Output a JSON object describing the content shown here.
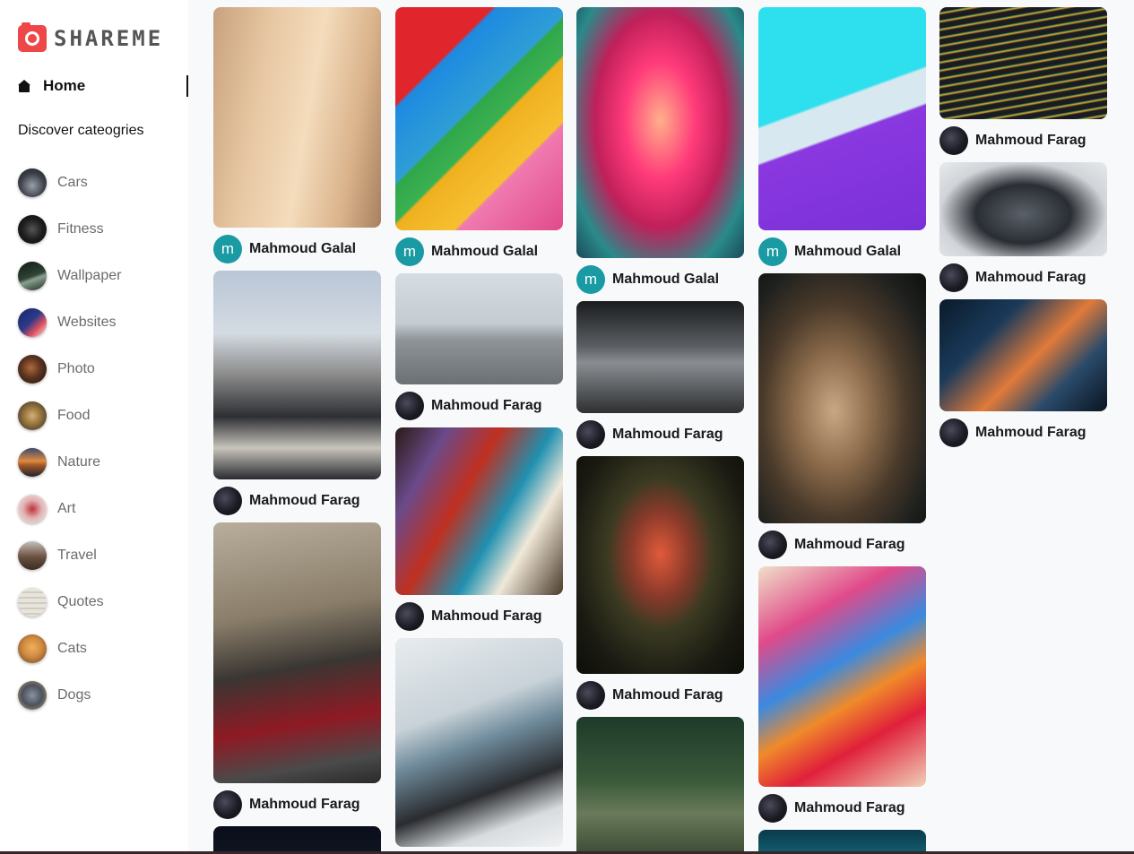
{
  "app": {
    "name": "SHAREME"
  },
  "nav": {
    "home_label": "Home",
    "discover_label": "Discover cateogries"
  },
  "categories": [
    {
      "label": "Cars",
      "color": "#3b3f48"
    },
    {
      "label": "Fitness",
      "color": "#1e1e1e"
    },
    {
      "label": "Wallpaper",
      "color": "#2f4436"
    },
    {
      "label": "Websites",
      "color": "#2b3a8a"
    },
    {
      "label": "Photo",
      "color": "#5a3320"
    },
    {
      "label": "Food",
      "color": "#8a6a3a"
    },
    {
      "label": "Nature",
      "color": "#a0582a"
    },
    {
      "label": "Art",
      "color": "#e0b0b0"
    },
    {
      "label": "Travel",
      "color": "#6a5040"
    },
    {
      "label": "Quotes",
      "color": "#e7e4dc"
    },
    {
      "label": "Cats",
      "color": "#d08a40"
    },
    {
      "label": "Dogs",
      "color": "#4a5260"
    }
  ],
  "pins": [
    {
      "user": "Mahmoud Galal",
      "avatar": "m",
      "image": "interior-lamp"
    },
    {
      "user": "Mahmoud Farag",
      "avatar": "",
      "image": "woman-running"
    },
    {
      "user": "Mahmoud Farag",
      "avatar": "",
      "image": "red-car"
    },
    {
      "user": "",
      "avatar": "",
      "image": "night-sky"
    },
    {
      "user": "Mahmoud Galal",
      "avatar": "m",
      "image": "colorful-wall"
    },
    {
      "user": "Mahmoud Farag",
      "avatar": "",
      "image": "man-running"
    },
    {
      "user": "Mahmoud Farag",
      "avatar": "",
      "image": "paint-brushes"
    },
    {
      "user": "",
      "avatar": "",
      "image": "desk-monitor"
    },
    {
      "user": "Mahmoud Galal",
      "avatar": "m",
      "image": "neon-corridor"
    },
    {
      "user": "Mahmoud Farag",
      "avatar": "",
      "image": "gym-workout"
    },
    {
      "user": "Mahmoud Farag",
      "avatar": "",
      "image": "flower-painting"
    },
    {
      "user": "",
      "avatar": "",
      "image": "forest-bridge"
    },
    {
      "user": "Mahmoud Galal",
      "avatar": "m",
      "image": "abstract-purple"
    },
    {
      "user": "Mahmoud Farag",
      "avatar": "",
      "image": "cat"
    },
    {
      "user": "Mahmoud Farag",
      "avatar": "",
      "image": "face-painting"
    },
    {
      "user": "",
      "avatar": "",
      "image": "tech-screen"
    },
    {
      "user": "Mahmoud Farag",
      "avatar": "",
      "image": "code-screen"
    },
    {
      "user": "Mahmoud Farag",
      "avatar": "",
      "image": "sports-car"
    },
    {
      "user": "Mahmoud Farag",
      "avatar": "",
      "image": "keyboard"
    }
  ]
}
